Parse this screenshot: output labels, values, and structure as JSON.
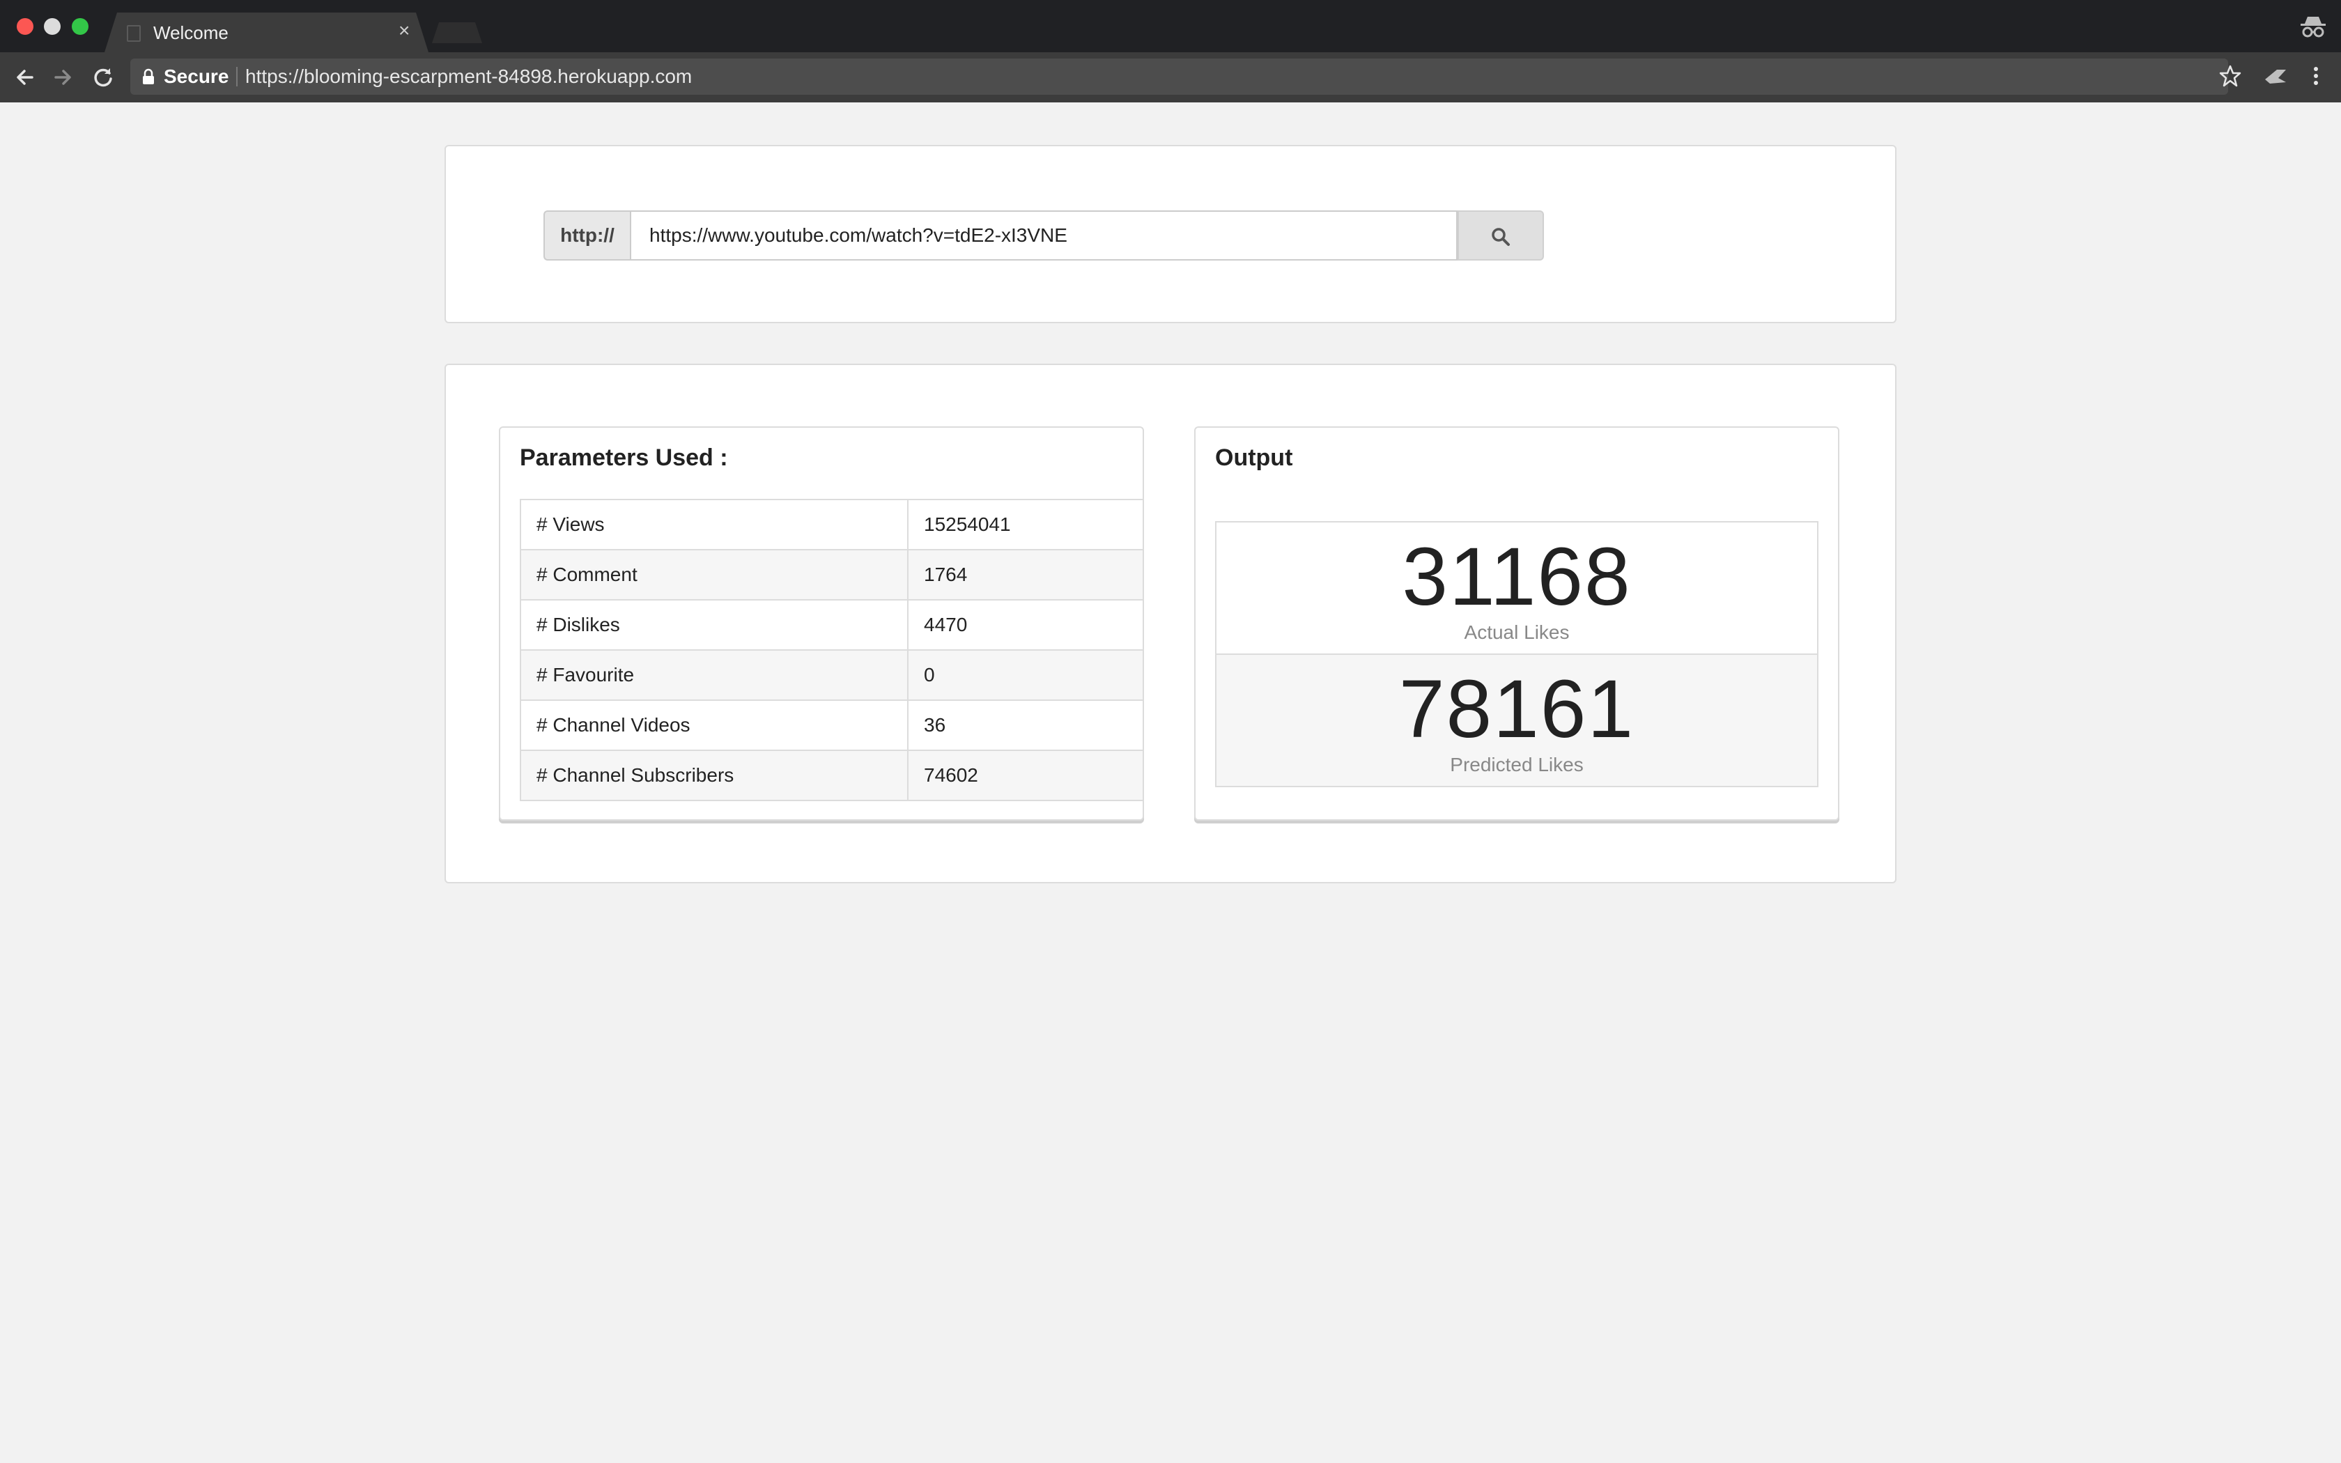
{
  "browser": {
    "tab_title": "Welcome",
    "tab_close": "×",
    "secure_label": "Secure",
    "url": "https://blooming-escarpment-84898.herokuapp.com"
  },
  "search": {
    "prefix": "http://",
    "value": "https://www.youtube.com/watch?v=tdE2-xI3VNE",
    "button_icon": "search-icon"
  },
  "parameters": {
    "title": "Parameters Used :",
    "rows": [
      {
        "label": "# Views",
        "value": "15254041"
      },
      {
        "label": "# Comment",
        "value": "1764"
      },
      {
        "label": "# Dislikes",
        "value": "4470"
      },
      {
        "label": "# Favourite",
        "value": "0"
      },
      {
        "label": "# Channel Videos",
        "value": "36"
      },
      {
        "label": "# Channel Subscribers",
        "value": "74602"
      }
    ]
  },
  "output": {
    "title": "Output",
    "actual": {
      "value": "31168",
      "label": "Actual Likes"
    },
    "predicted": {
      "value": "78161",
      "label": "Predicted Likes"
    }
  },
  "colors": {
    "titlebar": "#202124",
    "toolbar": "#3c3c3c",
    "page_bg": "#f2f2f2",
    "close": "#fc5753",
    "minimize": "#dcdcdc",
    "maximize": "#33c748"
  }
}
